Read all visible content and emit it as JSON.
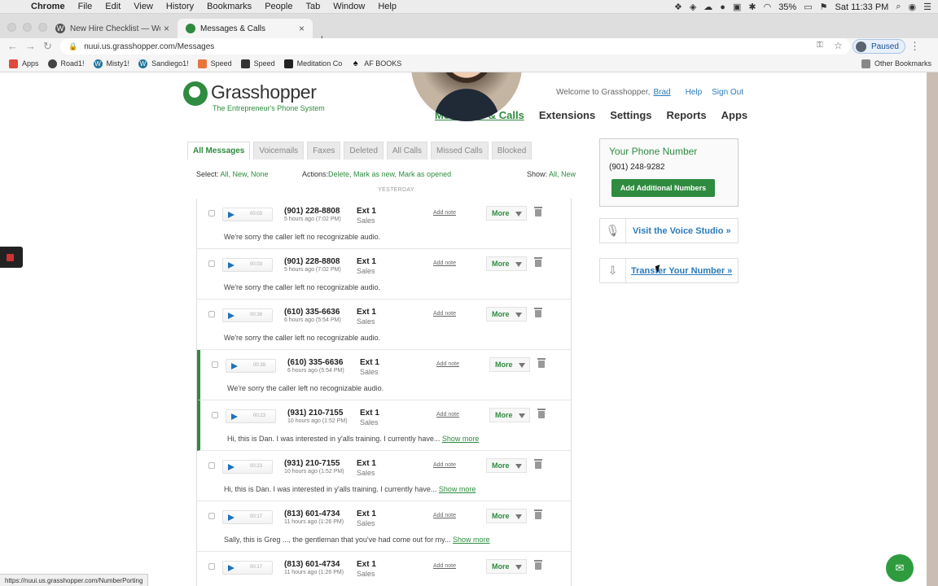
{
  "menubar": {
    "items": [
      "Chrome",
      "File",
      "Edit",
      "View",
      "History",
      "Bookmarks",
      "People",
      "Tab",
      "Window",
      "Help"
    ],
    "battery": "35%",
    "clock": "Sat 11:33 PM"
  },
  "browser": {
    "tabs": [
      {
        "title": "New Hire Checklist — Wonder",
        "active": false
      },
      {
        "title": "Messages & Calls",
        "active": true
      }
    ],
    "url": "nuui.us.grasshopper.com/Messages",
    "profile_label": "Paused",
    "bookmarks": [
      "Apps",
      "Road1!",
      "Misty1!",
      "Sandiego1!",
      "Speed",
      "Speed",
      "Meditation Co",
      "AF BOOKS"
    ],
    "other_bookmarks": "Other Bookmarks",
    "status_url": "https://nuui.us.grasshopper.com/NumberPorting"
  },
  "site": {
    "logo_name": "Grasshopper",
    "logo_tagline": "The Entrepreneur's Phone System",
    "welcome_text": "Welcome to Grasshopper,",
    "user_name": "Brad",
    "help": "Help",
    "sign_out": "Sign Out",
    "nav": [
      "Messages & Calls",
      "Extensions",
      "Settings",
      "Reports",
      "Apps"
    ]
  },
  "messages": {
    "tabs": [
      "All Messages",
      "Voicemails",
      "Faxes",
      "Deleted",
      "All Calls",
      "Missed Calls",
      "Blocked"
    ],
    "select_label": "Select:",
    "select_options": "All, New, None",
    "actions_label": "Actions:",
    "actions_options": "Delete, Mark as new, Mark as opened",
    "show_label": "Show:",
    "show_options": "All, New",
    "group_label": "YESTERDAY",
    "add_note": "Add note",
    "more": "More",
    "show_more": "Show more",
    "rows": [
      {
        "duration": "00:03",
        "number": "(901) 228-8808",
        "when": "5 hours ago (7:02 PM)",
        "ext": "Ext 1",
        "dept": "Sales",
        "text": "We're sorry the caller left no recognizable audio.",
        "has_more": false,
        "heard": false
      },
      {
        "duration": "00:03",
        "number": "(901) 228-8808",
        "when": "5 hours ago (7:02 PM)",
        "ext": "Ext 1",
        "dept": "Sales",
        "text": "We're sorry the caller left no recognizable audio.",
        "has_more": false,
        "heard": false
      },
      {
        "duration": "00:39",
        "number": "(610) 335-6636",
        "when": "6 hours ago (5:54 PM)",
        "ext": "Ext 1",
        "dept": "Sales",
        "text": "We're sorry the caller left no recognizable audio.",
        "has_more": false,
        "heard": false
      },
      {
        "duration": "00:39",
        "number": "(610) 335-6636",
        "when": "6 hours ago (5:54 PM)",
        "ext": "Ext 1",
        "dept": "Sales",
        "text": "We're sorry the caller left no recognizable audio.",
        "has_more": false,
        "heard": true
      },
      {
        "duration": "00:23",
        "number": "(931) 210-7155",
        "when": "10 hours ago (1:52 PM)",
        "ext": "Ext 1",
        "dept": "Sales",
        "text": "Hi, this is Dan. I was interested in y'alls training. I currently have...",
        "has_more": true,
        "heard": true
      },
      {
        "duration": "00:23",
        "number": "(931) 210-7155",
        "when": "10 hours ago (1:52 PM)",
        "ext": "Ext 1",
        "dept": "Sales",
        "text": "Hi, this is Dan. I was interested in y'alls training. I currently have...",
        "has_more": true,
        "heard": false
      },
      {
        "duration": "00:17",
        "number": "(813) 601-4734",
        "when": "11 hours ago (1:26 PM)",
        "ext": "Ext 1",
        "dept": "Sales",
        "text": "Sally, this is Greg ..., the gentleman that you've had come out for my...",
        "has_more": true,
        "heard": false
      },
      {
        "duration": "00:17",
        "number": "(813) 601-4734",
        "when": "11 hours ago (1:26 PM)",
        "ext": "Ext 1",
        "dept": "Sales",
        "text": "",
        "has_more": false,
        "heard": false
      }
    ]
  },
  "sidebar": {
    "phone_heading": "Your Phone Number",
    "phone_number": "(901) 248-9282",
    "add_numbers": "Add Additional Numbers",
    "voice_studio": "Visit the Voice Studio »",
    "transfer": "Transfer Your Number »"
  },
  "colors": {
    "brand_green": "#2e8b3f",
    "link_blue": "#2b7bb9"
  }
}
